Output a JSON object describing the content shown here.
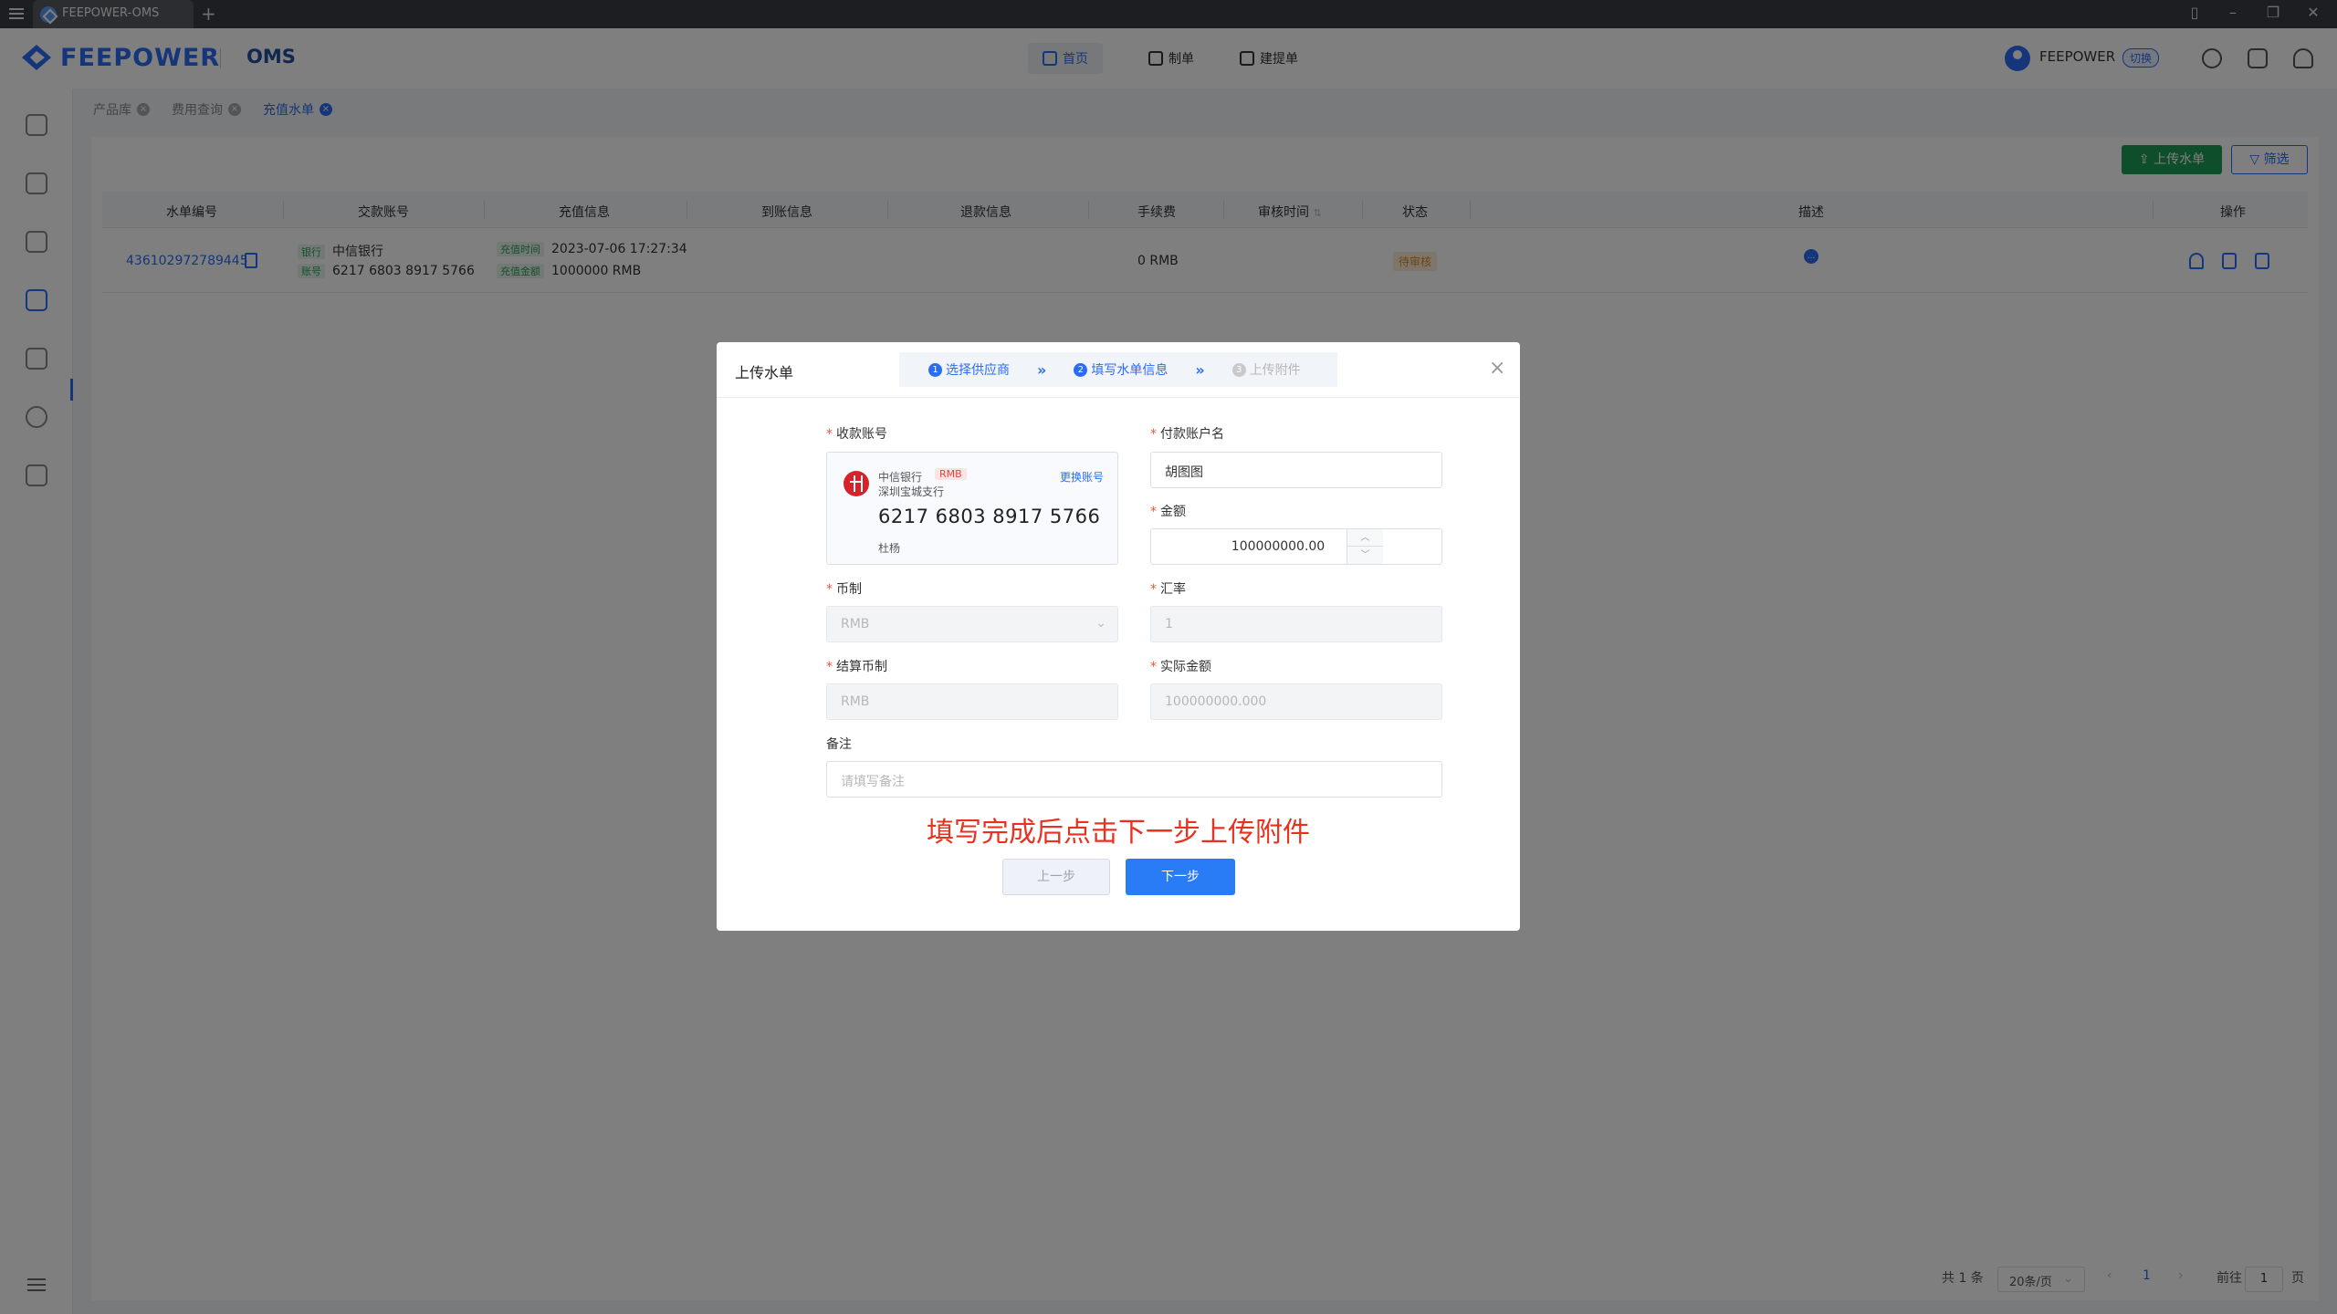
{
  "window": {
    "tab_title": "FEEPOWER-OMS"
  },
  "header": {
    "logo_text": "FEEPOWER",
    "oms_text": "OMS",
    "nav": [
      "首页",
      "制单",
      "建提单"
    ],
    "user_name": "FEEPOWER",
    "switch_label": "切换"
  },
  "breadcrumbs": [
    "产品库",
    "费用查询",
    "充值水单"
  ],
  "toolbar": {
    "upload_label": "上传水单",
    "filter_label": "筛选"
  },
  "table": {
    "headers": [
      "水单编号",
      "交款账号",
      "充值信息",
      "到账信息",
      "退款信息",
      "手续费",
      "审核时间",
      "状态",
      "描述",
      "操作"
    ],
    "row": {
      "id": "436102972789445",
      "bank_tag": "银行",
      "bank_value": "中信银行",
      "account_tag": "账号",
      "account_value": "6217 6803 8917 5766",
      "time_tag": "充值时间",
      "time_value": "2023-07-06 17:27:34",
      "amount_tag": "充值金额",
      "amount_value": "1000000 RMB",
      "fee": "0 RMB",
      "status": "待审核",
      "desc_icon": "..."
    }
  },
  "pagination": {
    "total": "共 1 条",
    "page_size": "20条/页",
    "current": "1",
    "goto_label": "前往",
    "goto_value": "1",
    "page_unit": "页"
  },
  "modal": {
    "title": "上传水单",
    "steps": [
      {
        "num": "1",
        "label": "选择供应商"
      },
      {
        "num": "2",
        "label": "填写水单信息"
      },
      {
        "num": "3",
        "label": "上传附件"
      }
    ],
    "receive_label": "收款账号",
    "bank_card": {
      "bank": "中信银行",
      "currency": "RMB",
      "branch": "深圳宝城支行",
      "change_label": "更换账号",
      "number": "6217 6803 8917 5766",
      "holder": "杜杨"
    },
    "payer_label": "付款账户名",
    "payer_value": "胡图图",
    "amount_label": "金额",
    "amount_value": "100000000.00",
    "currency_label": "币制",
    "currency_value": "RMB",
    "rate_label": "汇率",
    "rate_value": "1",
    "settle_label": "结算币制",
    "settle_value": "RMB",
    "actual_label": "实际金额",
    "actual_value": "100000000.000",
    "remark_label": "备注",
    "remark_placeholder": "请填写备注",
    "hint": "填写完成后点击下一步上传附件",
    "prev_label": "上一步",
    "next_label": "下一步"
  },
  "colors": {
    "accent": "#2a6df4",
    "upload_green": "#1f9d55",
    "hint_red": "#e8321f",
    "bank_red": "#d62229"
  }
}
